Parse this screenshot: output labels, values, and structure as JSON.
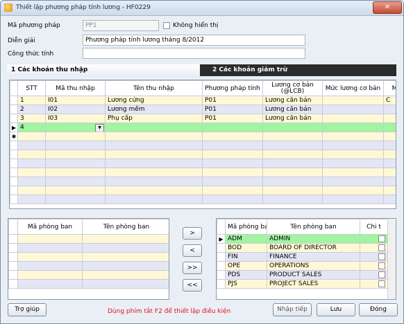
{
  "window": {
    "title": "Thiết lập phương pháp tính lương - HF0229",
    "close_label": "✕"
  },
  "form": {
    "method_code_label": "Mã phương pháp",
    "method_code_value": "PP1",
    "hide_label": "Không hiển thị",
    "description_label": "Diễn giải",
    "description_value": "Phương pháp tính lương tháng 8/2012",
    "formula_label": "Công thức tính",
    "formula_value": ""
  },
  "tabs": [
    {
      "label": "1 Các khoản thu nhập"
    },
    {
      "label": "2 Các khoản giảm trừ"
    }
  ],
  "income_grid": {
    "headers": [
      "STT",
      "Mã thu nhập",
      "Tên thu nhập",
      "Phương pháp tính",
      "Lương cơ bản (@LCB)",
      "Mức lương cơ bản",
      "M"
    ],
    "rows": [
      {
        "stt": "1",
        "code": "I01",
        "name": "Lương cứng",
        "method": "P01",
        "base": "Lương căn bản",
        "level": "",
        "m": "C"
      },
      {
        "stt": "2",
        "code": "I02",
        "name": "Lương mềm",
        "method": "P01",
        "base": "Lương căn bản",
        "level": "",
        "m": ""
      },
      {
        "stt": "3",
        "code": "I03",
        "name": "Phụ cấp",
        "method": "P01",
        "base": "Lương căn bản",
        "level": "",
        "m": ""
      },
      {
        "stt": "4",
        "code": "",
        "name": "",
        "method": "",
        "base": "",
        "level": "",
        "m": ""
      }
    ],
    "current_row_marker": "▶",
    "new_row_marker": "✱"
  },
  "left_dept_grid": {
    "headers": [
      "Mã phòng ban",
      "Tên phòng ban"
    ]
  },
  "right_dept_grid": {
    "headers": [
      "Mã phòng ban",
      "Tên phòng ban",
      "Chi t"
    ],
    "rows": [
      {
        "code": "ADM",
        "name": "ADMIN"
      },
      {
        "code": "BOD",
        "name": "BOARD OF DIRECTOR"
      },
      {
        "code": "FIN",
        "name": "FINANCE"
      },
      {
        "code": "OPE",
        "name": "OPERATIONS"
      },
      {
        "code": "PDS",
        "name": "PRODUCT SALES"
      },
      {
        "code": "PJS",
        "name": "PROJECT SALES"
      }
    ]
  },
  "transfer": {
    "move_right": ">",
    "move_left": "<",
    "move_all_right": ">>",
    "move_all_left": "<<"
  },
  "footer": {
    "help": "Trợ giúp",
    "hint": "Dùng phím tắt F2 để thiết lập điều kiện",
    "next": "Nhập tiếp",
    "save": "Lưu",
    "close": "Đóng"
  },
  "colors": {
    "selected_row": "#a1f5a1",
    "odd_row": "#fff8d6",
    "even_row": "#e4e6f6",
    "hint": "#e0111a"
  }
}
